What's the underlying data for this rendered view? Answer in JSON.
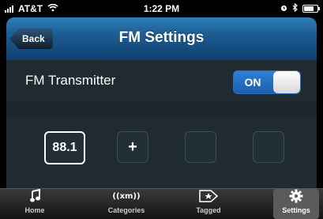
{
  "status_bar": {
    "carrier": "AT&T",
    "time": "1:22 PM",
    "icons": [
      "signal-icon",
      "wifi-icon",
      "alarm-icon",
      "bluetooth-icon",
      "battery-icon"
    ]
  },
  "navbar": {
    "title": "FM Settings",
    "back_label": "Back"
  },
  "settings": {
    "fm_transmitter_label": "FM Transmitter",
    "toggle_label": "ON",
    "toggle_state": true
  },
  "presets": {
    "items": [
      {
        "label": "88.1",
        "state": "active"
      },
      {
        "label": "+",
        "state": "add"
      },
      {
        "label": "",
        "state": "empty"
      },
      {
        "label": "",
        "state": "empty"
      }
    ]
  },
  "tabbar": {
    "tabs": [
      {
        "label": "Home",
        "icon": "music-note-icon",
        "selected": false
      },
      {
        "label": "Categories",
        "icon": "xm-radio-icon",
        "selected": false
      },
      {
        "label": "Tagged",
        "icon": "tag-icon",
        "selected": false
      },
      {
        "label": "Settings",
        "icon": "gear-icon",
        "selected": true
      }
    ]
  },
  "colors": {
    "nav_blue": "#1c5d92",
    "toggle_blue": "#2f7fd3",
    "background": "#1f2a31"
  }
}
